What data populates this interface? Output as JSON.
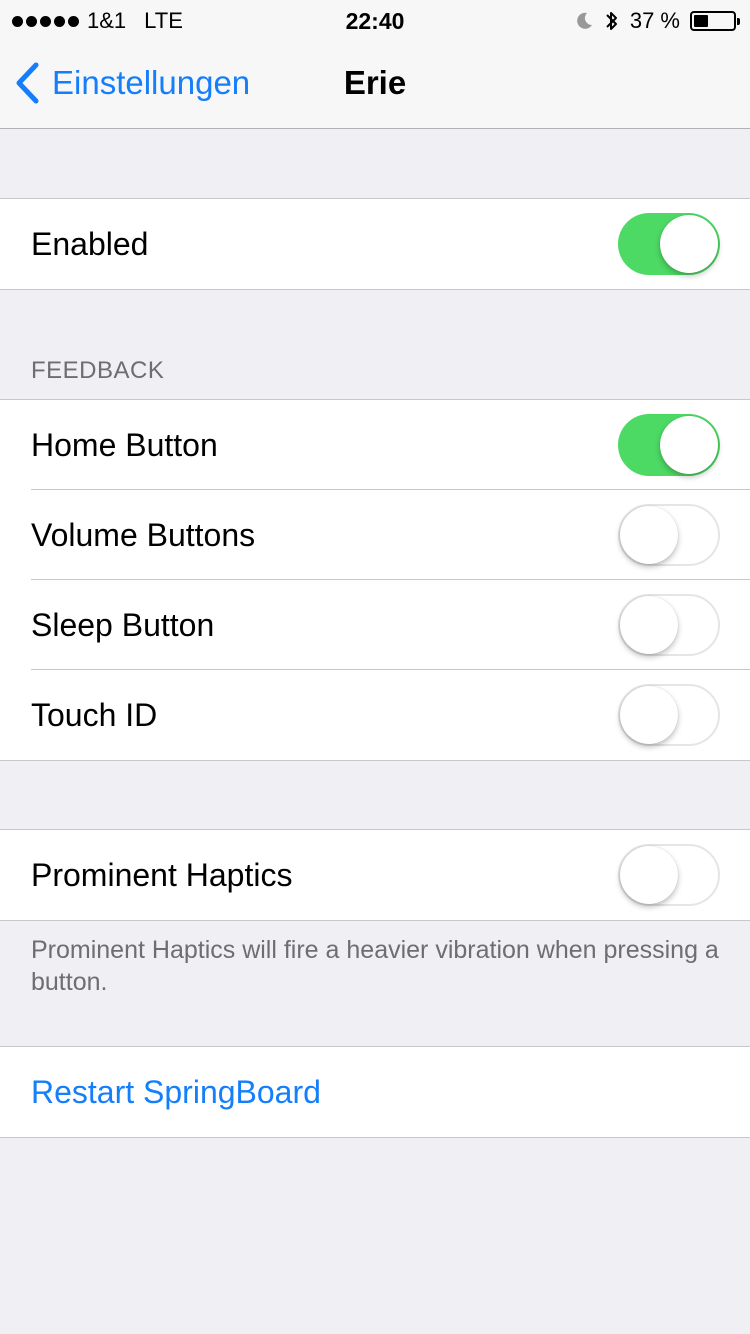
{
  "status_bar": {
    "carrier": "1&1",
    "network": "LTE",
    "time": "22:40",
    "battery_percent": "37 %",
    "icons": [
      "signal-dots-icon",
      "moon-icon",
      "bluetooth-icon",
      "battery-icon"
    ]
  },
  "nav": {
    "back_label": "Einstellungen",
    "title": "Erie"
  },
  "groups": {
    "enabled": {
      "label": "Enabled",
      "on": true
    },
    "feedback_header": "FEEDBACK",
    "feedback": [
      {
        "label": "Home Button",
        "on": true
      },
      {
        "label": "Volume Buttons",
        "on": false
      },
      {
        "label": "Sleep Button",
        "on": false
      },
      {
        "label": "Touch ID",
        "on": false
      }
    ],
    "haptics": {
      "label": "Prominent Haptics",
      "on": false
    },
    "haptics_footer": "Prominent Haptics will fire a heavier vibration when pressing a button.",
    "restart_label": "Restart SpringBoard"
  },
  "colors": {
    "accent": "#147efb",
    "toggle_on": "#4cd964",
    "background": "#efeff4"
  }
}
